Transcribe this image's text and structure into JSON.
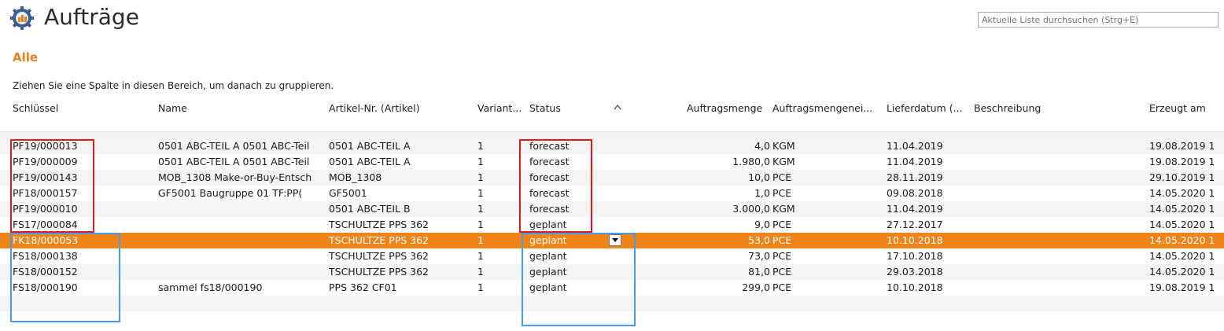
{
  "page": {
    "title": "Aufträge",
    "filter_title": "Alle"
  },
  "search": {
    "placeholder": "Aktuelle Liste durchsuchen (Strg+E)"
  },
  "group_hint": "Ziehen Sie eine Spalte in diesen Bereich, um danach zu gruppieren.",
  "columns": {
    "key": "Schlüssel",
    "name": "Name",
    "article": "Artikel-Nr. (Artikel)",
    "variant": "Variant...",
    "status": "Status",
    "qty": "Auftragsmenge",
    "unit": "Auftragsmengenei...",
    "delivery": "Lieferdatum (...",
    "desc": "Beschreibung",
    "created": "Erzeugt am"
  },
  "rows": [
    {
      "key": "PF19/000013",
      "name": "0501 ABC-TEIL A 0501 ABC-Teil",
      "article": "0501 ABC-TEIL A",
      "variant": "1",
      "status": "forecast",
      "qty": "4,0",
      "unit": "KGM",
      "delivery": "11.04.2019",
      "desc": "",
      "created": "19.08.2019 1"
    },
    {
      "key": "PF19/000009",
      "name": "0501 ABC-TEIL A 0501 ABC-Teil",
      "article": "0501 ABC-TEIL A",
      "variant": "1",
      "status": "forecast",
      "qty": "1.980,0",
      "unit": "KGM",
      "delivery": "11.04.2019",
      "desc": "",
      "created": "19.08.2019 1"
    },
    {
      "key": "PF19/000143",
      "name": "MOB_1308 Make-or-Buy-Entsch",
      "article": "MOB_1308",
      "variant": "1",
      "status": "forecast",
      "qty": "10,0",
      "unit": "PCE",
      "delivery": "28.11.2019",
      "desc": "",
      "created": "29.10.2019 1"
    },
    {
      "key": "PF18/000157",
      "name": "GF5001 Baugruppe 01      TF:PP(",
      "article": "GF5001",
      "variant": "1",
      "status": "forecast",
      "qty": "1,0",
      "unit": "PCE",
      "delivery": "09.08.2018",
      "desc": "",
      "created": "14.05.2020 1"
    },
    {
      "key": "PF19/000010",
      "name": "",
      "article": "0501 ABC-TEIL B",
      "variant": "1",
      "status": "forecast",
      "qty": "3.000,0",
      "unit": "KGM",
      "delivery": "11.04.2019",
      "desc": "",
      "created": "14.05.2020 1"
    },
    {
      "key": "FS17/000084",
      "name": "",
      "article": "TSCHULTZE PPS 362",
      "variant": "1",
      "status": "geplant",
      "qty": "9,0",
      "unit": "PCE",
      "delivery": "27.12.2017",
      "desc": "",
      "created": "14.05.2020 1"
    },
    {
      "key": "FK18/000053",
      "name": "",
      "article": "TSCHULTZE PPS 362",
      "variant": "1",
      "status": "geplant",
      "qty": "53,0",
      "unit": "PCE",
      "delivery": "10.10.2018",
      "desc": "",
      "created": "14.05.2020 1"
    },
    {
      "key": "FS18/000138",
      "name": "",
      "article": "TSCHULTZE PPS 362",
      "variant": "1",
      "status": "geplant",
      "qty": "73,0",
      "unit": "PCE",
      "delivery": "17.10.2018",
      "desc": "",
      "created": "14.05.2020 1"
    },
    {
      "key": "FS18/000152",
      "name": "",
      "article": "TSCHULTZE PPS 362",
      "variant": "1",
      "status": "geplant",
      "qty": "81,0",
      "unit": "PCE",
      "delivery": "29.03.2018",
      "desc": "",
      "created": "14.05.2020 1"
    },
    {
      "key": "FS18/000190",
      "name": "sammel fs18/000190",
      "article": "PPS 362 CF01",
      "variant": "1",
      "status": "geplant",
      "qty": "299,0",
      "unit": "PCE",
      "delivery": "10.10.2018",
      "desc": "",
      "created": "19.08.2019 1"
    }
  ],
  "selected_row": 6,
  "colors": {
    "accent": "#ef8419",
    "highlight_red": "#e01b1b",
    "highlight_blue": "#4b9ce8"
  },
  "icons": {
    "app": "orders-gear-icon",
    "sort": "sort-ascending-icon",
    "dropdown": "chevron-down-icon"
  }
}
